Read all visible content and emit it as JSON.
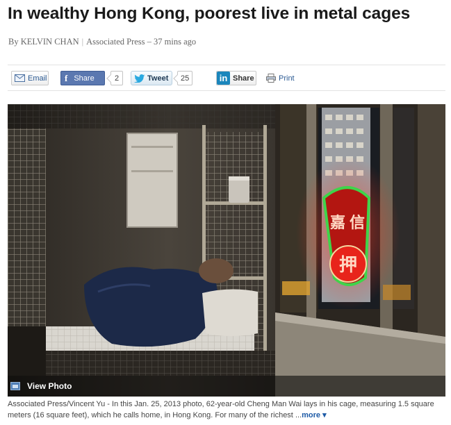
{
  "article": {
    "headline": "In wealthy Hong Kong, poorest live in metal cages",
    "byline_author": "By KELVIN CHAN",
    "byline_source": "Associated Press",
    "byline_time": "37 mins ago"
  },
  "share": {
    "email_label": "Email",
    "facebook_label": "Share",
    "facebook_count": "2",
    "twitter_label": "Tweet",
    "twitter_count": "25",
    "linkedin_label": "Share",
    "print_label": "Print"
  },
  "photo": {
    "view_photo_label": "View Photo",
    "sign_chars": [
      "嘉",
      "信",
      "押"
    ]
  },
  "caption": {
    "text": "Associated Press/Vincent Yu - In this Jan. 25, 2013 photo, 62-year-old Cheng Man Wai lays in his cage, measuring 1.5 square meters (16 square feet), which he calls home, in Hong Kong. For many of the richest",
    "ellipsis": "...",
    "more_label": "more"
  },
  "colors": {
    "facebook": "#5b78b0",
    "linkedin": "#1b86bc",
    "link": "#1d5aa6",
    "neon_red": "#e8241b",
    "neon_green": "#3fd44a"
  }
}
